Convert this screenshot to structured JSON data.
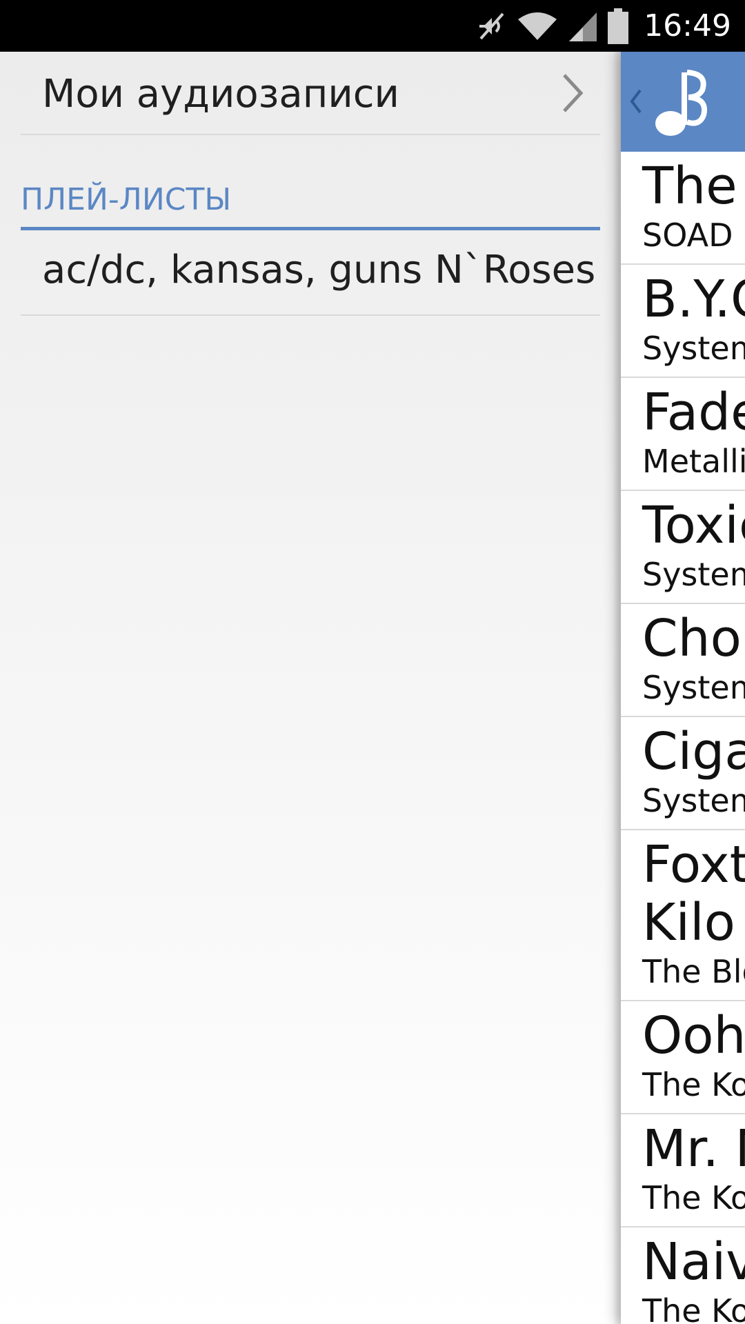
{
  "status_bar": {
    "time": "16:49",
    "icons": [
      "mute-icon",
      "wifi-icon",
      "signal-icon",
      "battery-icon"
    ]
  },
  "drawer": {
    "my_audio_label": "Мои аудиозаписи",
    "section_title": "ПЛЕЙ-ЛИСТЫ",
    "playlists": [
      {
        "label": "ac/dc, kansas, guns N`Roses"
      }
    ]
  },
  "main": {
    "header": {
      "back_icon": "chevron-left-icon",
      "logo_icon": "music-note-logo-icon"
    },
    "tracks": [
      {
        "title": "The I",
        "artist": "SOAD"
      },
      {
        "title": "B.Y.O",
        "artist": "System"
      },
      {
        "title": "Fade",
        "artist": "Metallic"
      },
      {
        "title": "Toxic",
        "artist": "System"
      },
      {
        "title": "Chop",
        "artist": "System"
      },
      {
        "title": "Cigar",
        "artist": "System"
      },
      {
        "title": "Foxtr",
        "title_line2": "Kilo",
        "artist": "The Blo"
      },
      {
        "title": "Ooh",
        "artist": "The Ko"
      },
      {
        "title": "Mr. N",
        "artist": "The Ko"
      },
      {
        "title": "Naive",
        "artist": "The Ko"
      }
    ]
  },
  "colors": {
    "accent": "#5b87c4",
    "status_bar": "#000000",
    "divider": "#d9d9d9"
  }
}
